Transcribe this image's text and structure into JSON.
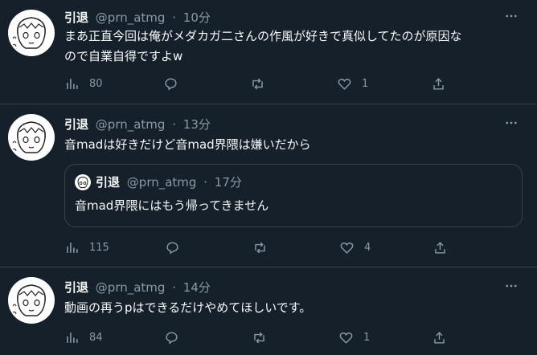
{
  "colors": {
    "background": "#15202b",
    "text": "#f7f9f9",
    "muted": "#8b98a5",
    "border": "#38444d"
  },
  "tweets": [
    {
      "name": "引退",
      "handle": "@prn_atmg",
      "dot": "·",
      "time": "10分",
      "text_line1": "まあ正直今回は俺がメダカガ二さんの作風が好きで真似してたのが原因な",
      "text_line2": "ので自業自得ですよw",
      "views": "80",
      "likes": "1"
    },
    {
      "name": "引退",
      "handle": "@prn_atmg",
      "dot": "·",
      "time": "13分",
      "text": "音madは好きだけど音mad界隈は嫌いだから",
      "quote": {
        "name": "引退",
        "handle": "@prn_atmg",
        "dot": "·",
        "time": "17分",
        "text": "音mad界隈にはもう帰ってきません"
      },
      "views": "115",
      "likes": "4"
    },
    {
      "name": "引退",
      "handle": "@prn_atmg",
      "dot": "·",
      "time": "14分",
      "text": "動画の再うpはできるだけやめてほしいです。",
      "views": "84",
      "likes": "1"
    }
  ]
}
